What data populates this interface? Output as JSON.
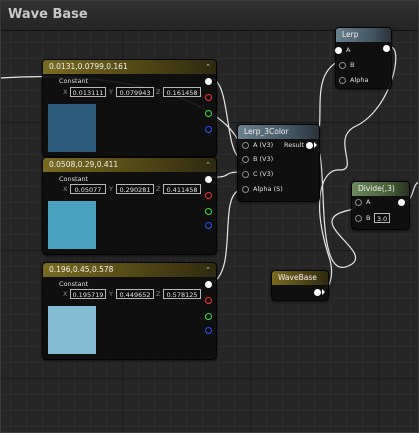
{
  "editor": {
    "title": "Wave Base"
  },
  "constant_nodes": [
    {
      "header": "0.0131,0.0799,0.161",
      "label": "Constant",
      "x": "0.013111",
      "y": "0.079943",
      "z": "0.161458",
      "color": "#2c5a7a"
    },
    {
      "header": "0.0508,0.29,0.411",
      "label": "Constant",
      "x": "0.05077",
      "y": "0.290281",
      "z": "0.411458",
      "color": "#4aa0bf"
    },
    {
      "header": "0.196,0.45,0.578",
      "label": "Constant",
      "x": "0.195719",
      "y": "0.449652",
      "z": "0.578125",
      "color": "#84bcd4"
    }
  ],
  "axis_labels": {
    "x": "X",
    "y": "Y",
    "z": "Z"
  },
  "lerp_node": {
    "header": "Lerp",
    "inputs": [
      "A",
      "B",
      "Alpha"
    ]
  },
  "lerp3_node": {
    "header": "Lerp_3Color",
    "inputs": [
      "A (V3)",
      "B (V3)",
      "C (V3)",
      "Alpha (S)"
    ],
    "output": "Result"
  },
  "divide_node": {
    "header": "Divide(,3)",
    "inputs": [
      "A",
      "B"
    ],
    "b_value": "3.0"
  },
  "wavebase_node": {
    "header": "WaveBase"
  },
  "colors": {
    "constant_header": "#7a6a20",
    "lerp_header": "#6a8190",
    "divide_header": "#6c8a5c",
    "wavebase_header": "#7a6a20"
  }
}
